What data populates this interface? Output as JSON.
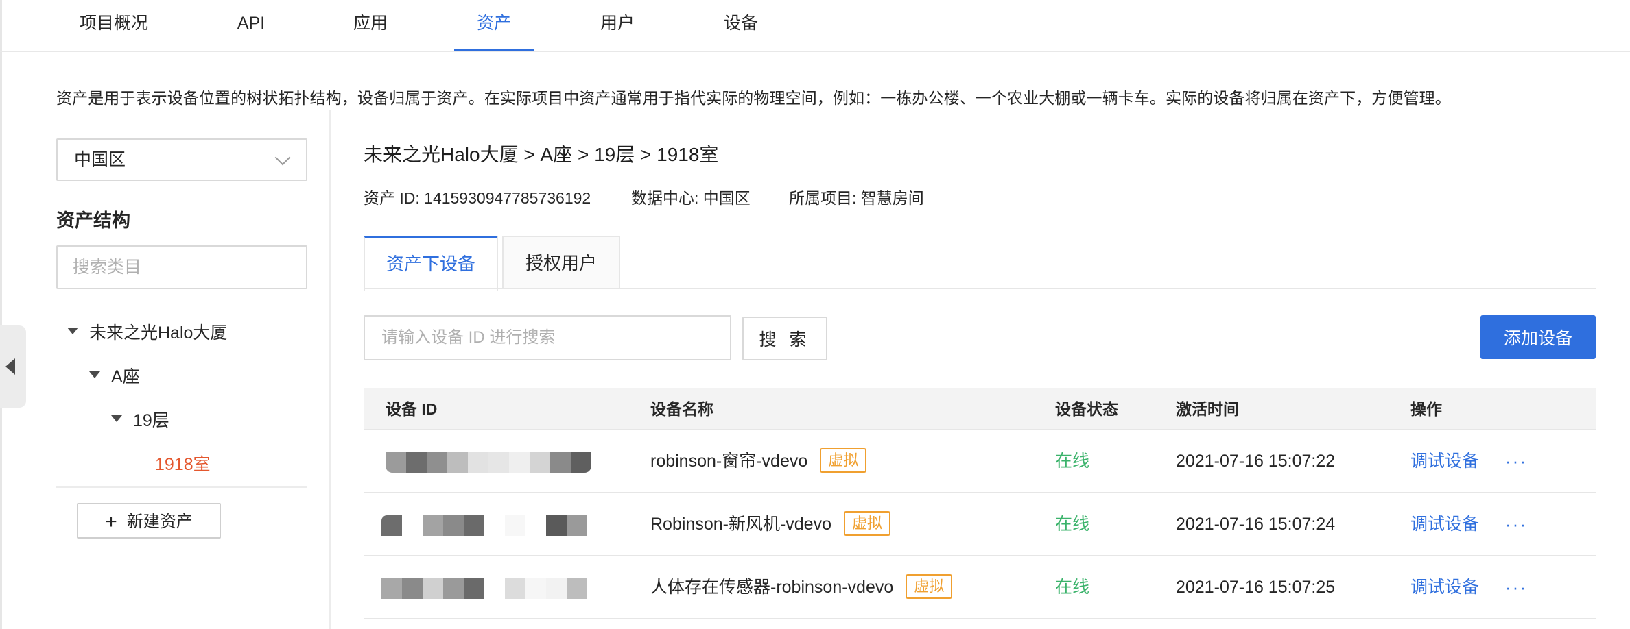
{
  "top_tabs": [
    {
      "label": "项目概况",
      "active": false
    },
    {
      "label": "API",
      "active": false
    },
    {
      "label": "应用",
      "active": false
    },
    {
      "label": "资产",
      "active": true
    },
    {
      "label": "用户",
      "active": false
    },
    {
      "label": "设备",
      "active": false
    }
  ],
  "description": "资产是用于表示设备位置的树状拓扑结构，设备归属于资产。在实际项目中资产通常用于指代实际的物理空间，例如：一栋办公楼、一个农业大棚或一辆卡车。实际的设备将归属在资产下，方便管理。",
  "sidebar": {
    "region": "中国区",
    "section_title": "资产结构",
    "search_placeholder": "搜索类目",
    "tree": [
      {
        "label": "未来之光Halo大厦",
        "expanded": true
      },
      {
        "label": "A座",
        "expanded": true
      },
      {
        "label": "19层",
        "expanded": true
      },
      {
        "label": "1918室",
        "selected": true
      }
    ],
    "new_asset_label": "新建资产",
    "new_asset_icon": "plus-icon"
  },
  "main": {
    "breadcrumb": "未来之光Halo大厦 > A座 > 19层 > 1918室",
    "asset_id": "资产 ID: 1415930947785736192",
    "data_center": "数据中心: 中国区",
    "project": "所属项目: 智慧房间",
    "sub_tabs": [
      {
        "label": "资产下设备",
        "active": true
      },
      {
        "label": "授权用户",
        "active": false
      }
    ],
    "device_search_placeholder": "请输入设备 ID 进行搜索",
    "search_label": "搜 索",
    "add_device_label": "添加设备"
  },
  "table": {
    "columns": [
      "设备 ID",
      "设备名称",
      "设备状态",
      "激活时间",
      "操作"
    ],
    "rows": [
      {
        "name": "robinson-窗帘-vdevo",
        "badge": "虚拟",
        "status": "在线",
        "time": "2021-07-16 15:07:22",
        "action": "调试设备",
        "more": "···"
      },
      {
        "name": "Robinson-新风机-vdevo",
        "badge": "虚拟",
        "status": "在线",
        "time": "2021-07-16 15:07:24",
        "action": "调试设备",
        "more": "···"
      },
      {
        "name": "人体存在传感器-robinson-vdevo",
        "badge": "虚拟",
        "status": "在线",
        "time": "2021-07-16 15:07:25",
        "action": "调试设备",
        "more": "···"
      }
    ]
  },
  "colors": {
    "accent": "#2f6fde",
    "online": "#3bb36b",
    "virtual_badge": "#f0a030",
    "selected_node": "#e4572e"
  }
}
